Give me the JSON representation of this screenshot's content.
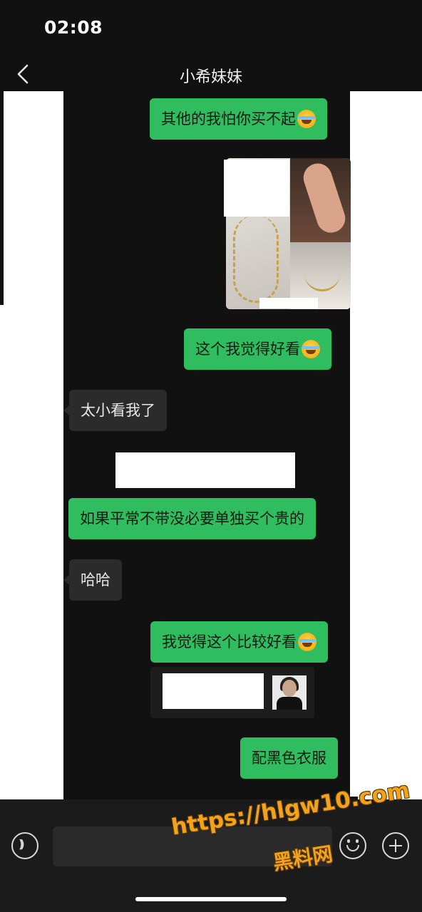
{
  "status_bar": {
    "time": "02:08"
  },
  "header": {
    "title": "小希妹妹",
    "back_icon": "chevron-left-icon"
  },
  "messages": [
    {
      "side": "me",
      "text": "其他的我怕你买不起",
      "emoji": "laughing-crying-emoji"
    },
    {
      "side": "me",
      "type": "image-collage"
    },
    {
      "side": "me",
      "text": "这个我觉得好看",
      "emoji": "laughing-crying-emoji"
    },
    {
      "side": "them",
      "text": "太小看我了"
    },
    {
      "side": "me",
      "text": "如果平常不带没必要单独买个贵的"
    },
    {
      "side": "them",
      "text": "哈哈"
    },
    {
      "side": "me",
      "text": "我觉得这个比较好看",
      "emoji": "laughing-crying-emoji"
    },
    {
      "side": "me",
      "type": "link-card"
    },
    {
      "side": "me",
      "text": "配黑色衣服"
    }
  ],
  "bottom_bar": {
    "voice_icon": "voice-icon",
    "emoji_icon": "emoji-icon",
    "plus_icon": "plus-icon"
  },
  "watermark": {
    "url": "https://hlgw10.com",
    "cn": "黑料网"
  },
  "colors": {
    "my_bubble": "#2fbd5f",
    "their_bubble": "#2b2b2b",
    "background": "#111111",
    "watermark": "#f3a21c"
  }
}
